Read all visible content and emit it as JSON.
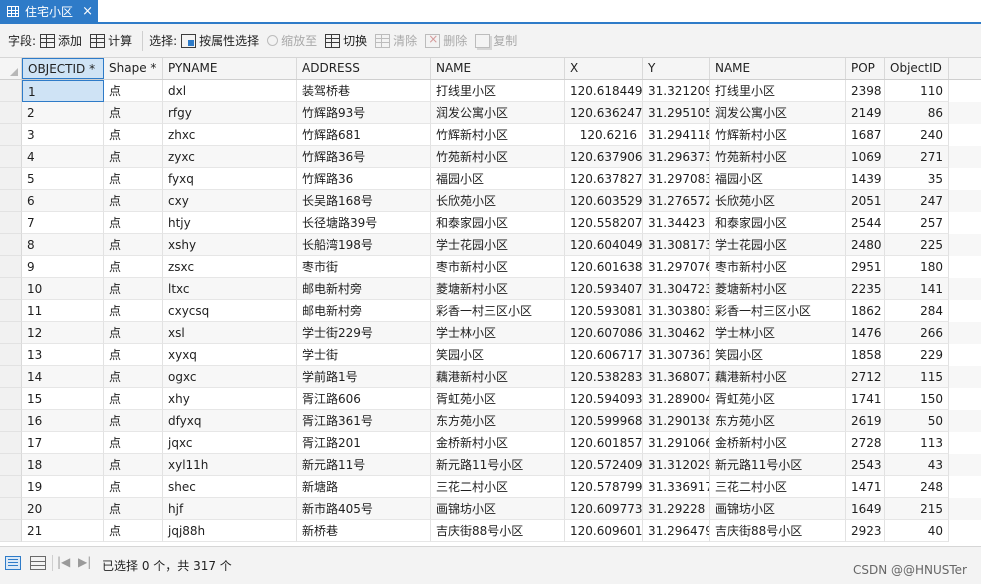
{
  "tab": {
    "title": "住宅小区",
    "close": "×",
    "color": "#2e7bc8"
  },
  "toolbar": {
    "field_label": "字段:",
    "add": "添加",
    "calculate": "计算",
    "selection_label": "选择:",
    "select_by_attr": "按属性选择",
    "zoom_to": "缩放至",
    "switch": "切换",
    "clear": "清除",
    "delete": "删除",
    "copy": "复制"
  },
  "table": {
    "columns": [
      "OBJECTID *",
      "Shape *",
      "PYNAME",
      "ADDRESS",
      "NAME",
      "X",
      "Y",
      "NAME",
      "POP",
      "ObjectID"
    ],
    "rows": [
      [
        "1",
        "点",
        "dxl",
        "装驾桥巷",
        "打线里小区",
        "120.618449",
        "31.321209",
        "打线里小区",
        "2398",
        "110"
      ],
      [
        "2",
        "点",
        "rfgy",
        "竹辉路93号",
        "润发公寓小区",
        "120.636247",
        "31.295105",
        "润发公寓小区",
        "2149",
        "86"
      ],
      [
        "3",
        "点",
        "zhxc",
        "竹辉路681",
        "竹辉新村小区",
        "120.6216",
        "31.294118",
        "竹辉新村小区",
        "1687",
        "240"
      ],
      [
        "4",
        "点",
        "zyxc",
        "竹辉路36号",
        "竹苑新村小区",
        "120.637906",
        "31.296373",
        "竹苑新村小区",
        "1069",
        "271"
      ],
      [
        "5",
        "点",
        "fyxq",
        "竹辉路36",
        "福园小区",
        "120.637827",
        "31.297083",
        "福园小区",
        "1439",
        "35"
      ],
      [
        "6",
        "点",
        "cxy",
        "长吴路168号",
        "长欣苑小区",
        "120.603529",
        "31.276572",
        "长欣苑小区",
        "2051",
        "247"
      ],
      [
        "7",
        "点",
        "htjy",
        "长径塘路39号",
        "和泰家园小区",
        "120.558207",
        "31.34423",
        "和泰家园小区",
        "2544",
        "257"
      ],
      [
        "8",
        "点",
        "xshy",
        "长船湾198号",
        "学士花园小区",
        "120.604049",
        "31.308173",
        "学士花园小区",
        "2480",
        "225"
      ],
      [
        "9",
        "点",
        "zsxc",
        "枣市街",
        "枣市新村小区",
        "120.601638",
        "31.297076",
        "枣市新村小区",
        "2951",
        "180"
      ],
      [
        "10",
        "点",
        "ltxc",
        "邮电新村旁",
        "菱塘新村小区",
        "120.593407",
        "31.304723",
        "菱塘新村小区",
        "2235",
        "141"
      ],
      [
        "11",
        "点",
        "cxycsq",
        "邮电新村旁",
        "彩香一村三区小区",
        "120.593081",
        "31.303803",
        "彩香一村三区小区",
        "1862",
        "284"
      ],
      [
        "12",
        "点",
        "xsl",
        "学士街229号",
        "学士林小区",
        "120.607086",
        "31.30462",
        "学士林小区",
        "1476",
        "266"
      ],
      [
        "13",
        "点",
        "xyxq",
        "学士街",
        "笑园小区",
        "120.606717",
        "31.307361",
        "笑园小区",
        "1858",
        "229"
      ],
      [
        "14",
        "点",
        "ogxc",
        "学前路1号",
        "藕港新村小区",
        "120.538283",
        "31.368077",
        "藕港新村小区",
        "2712",
        "115"
      ],
      [
        "15",
        "点",
        "xhy",
        "胥江路606",
        "胥虹苑小区",
        "120.594093",
        "31.289004",
        "胥虹苑小区",
        "1741",
        "150"
      ],
      [
        "16",
        "点",
        "dfyxq",
        "胥江路361号",
        "东方苑小区",
        "120.599968",
        "31.290138",
        "东方苑小区",
        "2619",
        "50"
      ],
      [
        "17",
        "点",
        "jqxc",
        "胥江路201",
        "金桥新村小区",
        "120.601857",
        "31.291066",
        "金桥新村小区",
        "2728",
        "113"
      ],
      [
        "18",
        "点",
        "xyl11h",
        "新元路11号",
        "新元路11号小区",
        "120.572409",
        "31.312029",
        "新元路11号小区",
        "2543",
        "43"
      ],
      [
        "19",
        "点",
        "shec",
        "新塘路",
        "三花二村小区",
        "120.578799",
        "31.336917",
        "三花二村小区",
        "1471",
        "248"
      ],
      [
        "20",
        "点",
        "hjf",
        "新市路405号",
        "画锦坊小区",
        "120.609773",
        "31.29228",
        "画锦坊小区",
        "1649",
        "215"
      ],
      [
        "21",
        "点",
        "jqj88h",
        "新桥巷",
        "吉庆街88号小区",
        "120.609601",
        "31.296479",
        "吉庆街88号小区",
        "2923",
        "40"
      ]
    ]
  },
  "status": {
    "text": "已选择 0 个，共 317 个",
    "first": "|◀",
    "last": "▶|"
  },
  "watermark": "CSDN @@HNUSTer"
}
